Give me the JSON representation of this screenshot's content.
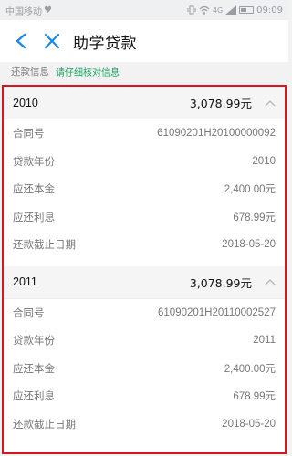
{
  "status_bar": {
    "carrier": "中国移动",
    "network": "4G",
    "time": "09:09"
  },
  "nav": {
    "title": "助学贷款"
  },
  "info": {
    "label": "还款信息",
    "hint": "请仔细核对信息"
  },
  "loans": [
    {
      "year": "2010",
      "total": "3,078.99元",
      "rows": [
        {
          "label": "合同号",
          "value": "61090201H20100000092"
        },
        {
          "label": "贷款年份",
          "value": "2010"
        },
        {
          "label": "应还本金",
          "value": "2,400.00元"
        },
        {
          "label": "应还利息",
          "value": "678.99元"
        },
        {
          "label": "还款截止日期",
          "value": "2018-05-20"
        }
      ]
    },
    {
      "year": "2011",
      "total": "3,078.99元",
      "rows": [
        {
          "label": "合同号",
          "value": "61090201H20110002527"
        },
        {
          "label": "贷款年份",
          "value": "2011"
        },
        {
          "label": "应还本金",
          "value": "2,400.00元"
        },
        {
          "label": "应还利息",
          "value": "678.99元"
        },
        {
          "label": "还款截止日期",
          "value": "2018-05-20"
        }
      ]
    }
  ],
  "colors": {
    "accent": "#1e88e5",
    "hint_green": "#19a463",
    "highlight_border": "#d9161f"
  }
}
